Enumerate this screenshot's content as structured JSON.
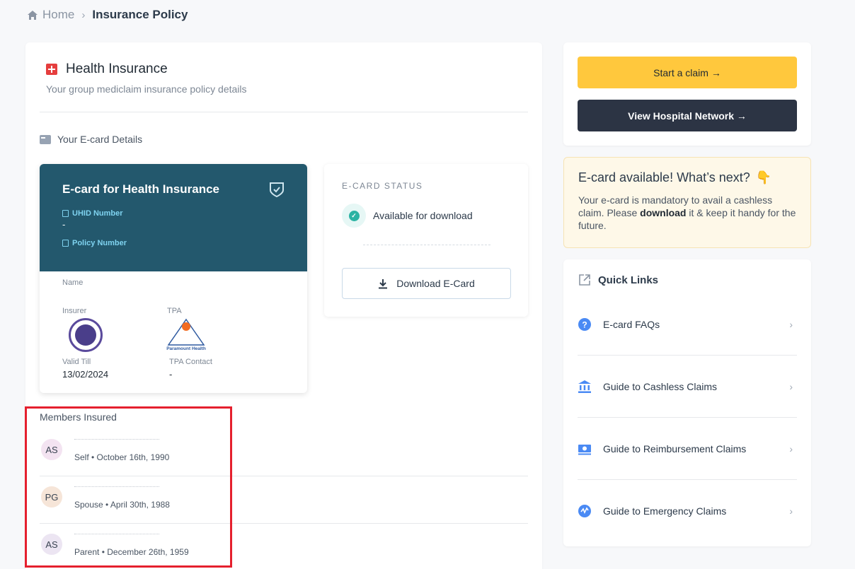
{
  "breadcrumb": {
    "home": "Home",
    "current": "Insurance Policy"
  },
  "policy": {
    "title": "Health Insurance",
    "subtitle": "Your group mediclaim insurance policy details",
    "ecard_section": "Your E-card Details"
  },
  "ecard": {
    "title": "E-card for Health Insurance",
    "uhid_label": "UHID Number",
    "uhid_value": "-",
    "policy_label": "Policy Number",
    "policy_value": "",
    "name_label": "Name",
    "insurer_label": "Insurer",
    "tpa_label": "TPA",
    "tpa_logo_text": "Paramount Health",
    "valid_label": "Valid Till",
    "valid_value": "13/02/2024",
    "tpa_contact_label": "TPA Contact",
    "tpa_contact_value": "-"
  },
  "status": {
    "label": "E-CARD STATUS",
    "text": "Available for download",
    "download_button": "Download E-Card"
  },
  "members": {
    "title": "Members Insured",
    "items": [
      {
        "initials": "AS",
        "info": "Self • October 16th, 1990",
        "color": "#f3e3f1"
      },
      {
        "initials": "PG",
        "info": "Spouse • April 30th, 1988",
        "color": "#f6e5d8"
      },
      {
        "initials": "AS",
        "info": "Parent • December 26th, 1959",
        "color": "#ece5f2"
      }
    ]
  },
  "actions": {
    "start_claim": "Start a claim →",
    "view_network": "View Hospital Network →"
  },
  "info": {
    "title": "E-card available! What’s next?",
    "hand_emoji": "👇",
    "text_before": "Your e-card is mandatory to avail a cashless claim. Please ",
    "text_bold": "download",
    "text_after": " it & keep it handy for the future."
  },
  "quick_links": {
    "title": "Quick Links",
    "items": [
      {
        "label": "E-card FAQs",
        "icon": "question-icon"
      },
      {
        "label": "Guide to Cashless Claims",
        "icon": "bank-icon"
      },
      {
        "label": "Guide to Reimbursement Claims",
        "icon": "cash-icon"
      },
      {
        "label": "Guide to Emergency Claims",
        "icon": "emergency-icon"
      }
    ]
  },
  "colors": {
    "ecard_bg": "#23586d",
    "start_claim_bg": "#ffc83d",
    "network_bg": "#2c3444",
    "accent_blue": "#4a8af4",
    "highlight": "#e5202e"
  }
}
